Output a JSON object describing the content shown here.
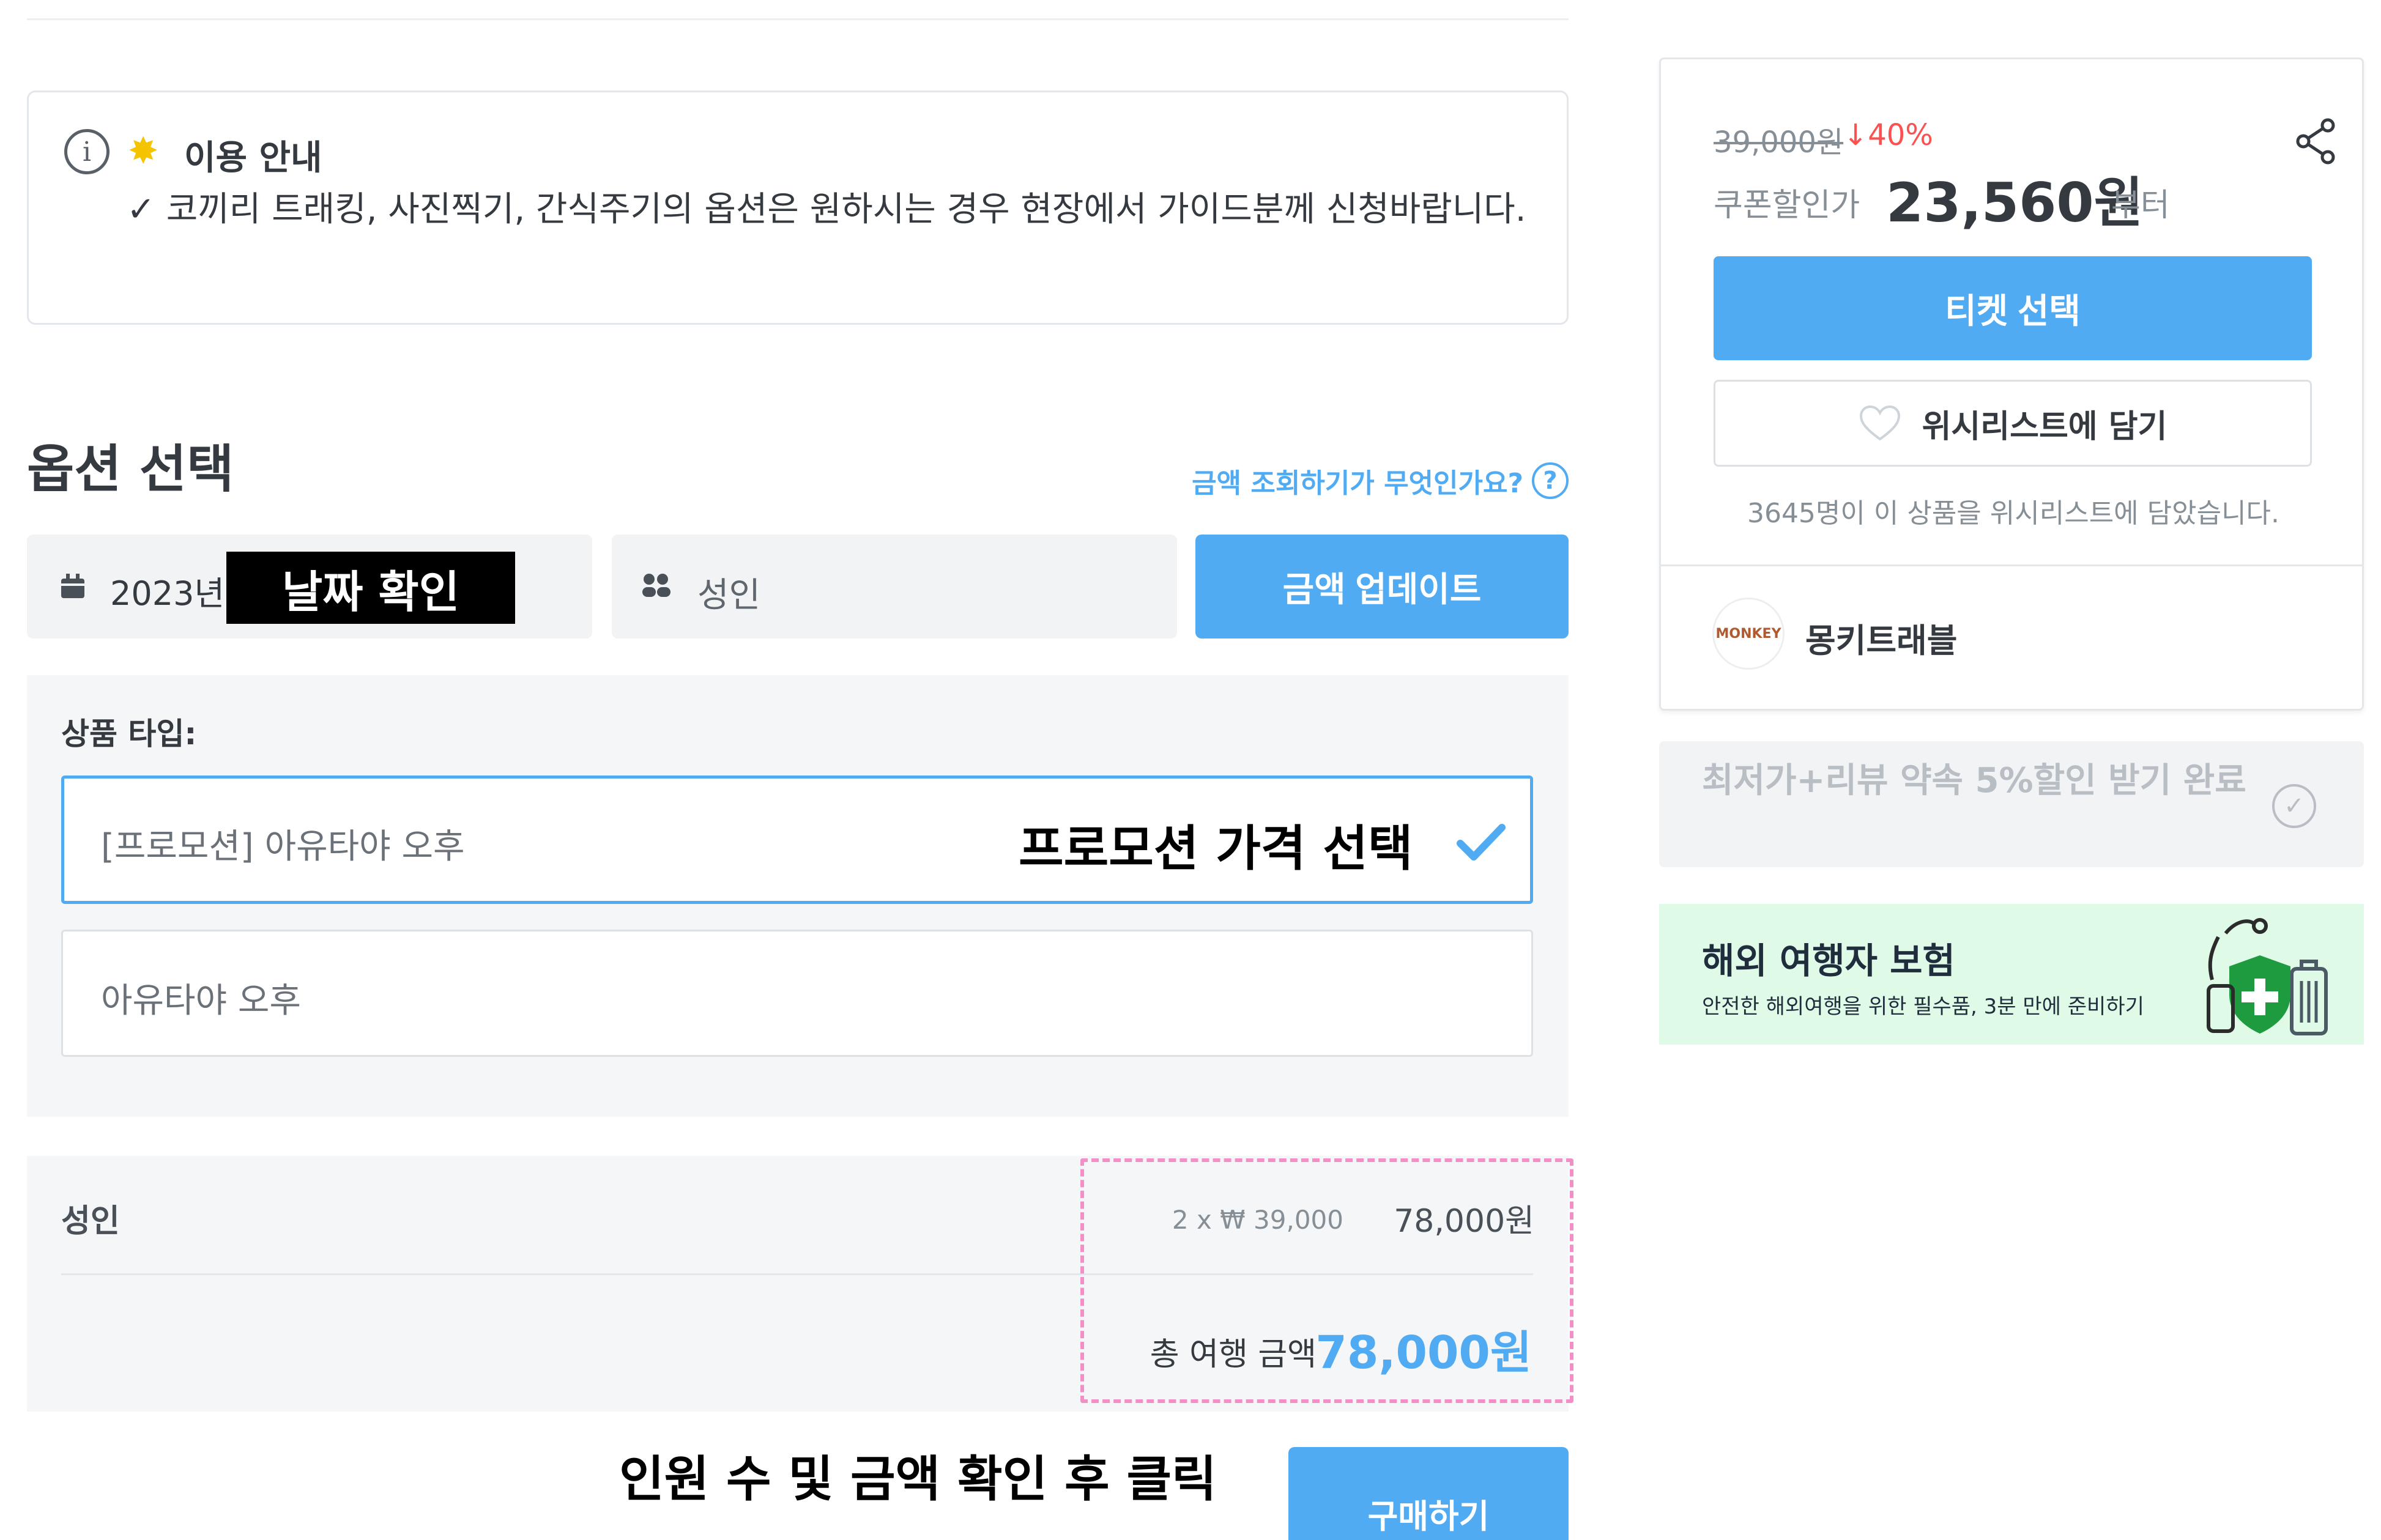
{
  "notice": {
    "title": "이용 안내",
    "body": "✓ 코끼리 트래킹, 사진찍기, 간식주기의 옵션은 원하시는 경우 현장에서 가이드분께 신청바랍니다."
  },
  "options": {
    "title": "옵션 선택",
    "help_link": "금액 조회하기가 무엇인가요?",
    "date_value": "2023년",
    "pax_value": "성인",
    "update_button": "금액 업데이트",
    "product_type_label": "상품 타입:",
    "product_types": [
      {
        "label": "[프로모션] 아유타야 오후",
        "selected": true
      },
      {
        "label": "아유타야 오후",
        "selected": false
      }
    ]
  },
  "summary": {
    "row_label": "성인",
    "row_calc": "2 x ₩ 39,000",
    "row_amount": "78,000원",
    "total_label": "총 여행 금액",
    "total_amount": "78,000원",
    "buy_button": "구매하기"
  },
  "annotations": {
    "date_check": "날짜 확인",
    "promo_select": "프로모션 가격 선택",
    "click_hint": "인원 수 및 금액 확인 후 클릭"
  },
  "sidebar": {
    "original_price": "39,000원",
    "discount": "↓40%",
    "coupon_label": "쿠폰할인가",
    "coupon_price": "23,560원",
    "coupon_suffix": "부터",
    "ticket_button": "티켓 선택",
    "wishlist_button": "위시리스트에 담기",
    "wishlist_count": "3645명이 이 상품을 위시리스트에 담았습니다.",
    "seller_name": "몽키트래블",
    "seller_logo_text": "MONKEY",
    "promise_text": "최저가+리뷰 약속 5%할인 받기 완료",
    "insurance_title": "해외 여행자 보험",
    "insurance_sub": "안전한 해외여행을 위한 필수품, 3분 만에 준비하기"
  },
  "colors": {
    "accent": "#51abf3",
    "discount": "#fa5252",
    "annotation_dash": "#f28fc7",
    "insurance_bg": "#dffbe8"
  },
  "icons": {
    "info": "info-circle-icon",
    "notice": "sparkle-star-icon",
    "help": "question-circle-icon",
    "calendar": "calendar-icon",
    "pax": "people-icon",
    "check": "checkmark-icon",
    "share": "share-icon",
    "heart": "heart-outline-icon",
    "promise": "check-circle-icon",
    "insurance": "shield-plus-luggage-icon"
  }
}
